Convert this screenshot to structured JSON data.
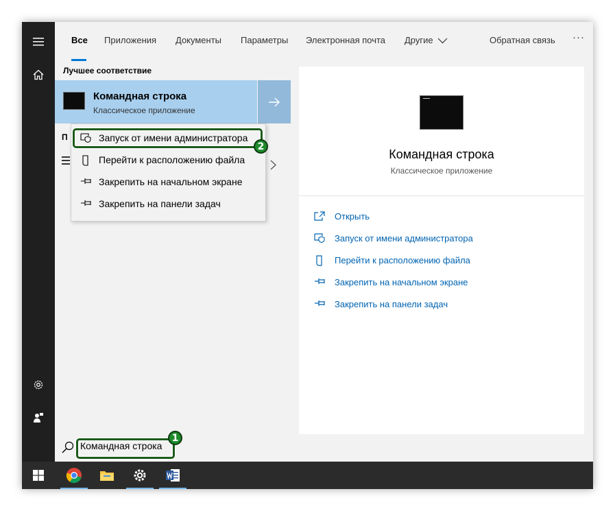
{
  "tabs": [
    {
      "label": "Все",
      "active": true
    },
    {
      "label": "Приложения"
    },
    {
      "label": "Документы"
    },
    {
      "label": "Параметры"
    },
    {
      "label": "Электронная почта"
    },
    {
      "label": "Другие"
    }
  ],
  "feedback_label": "Обратная связь",
  "more_label": "···",
  "results": {
    "best_match_heading": "Лучшее соответствие",
    "best_match": {
      "title": "Командная строка",
      "subtitle": "Классическое приложение"
    },
    "partial_heading": "П"
  },
  "context_menu": {
    "items": [
      {
        "label": "Запуск от имени администратора",
        "icon": "shield-icon"
      },
      {
        "label": "Перейти к расположению файла",
        "icon": "file-location-icon"
      },
      {
        "label": "Закрепить на начальном экране",
        "icon": "pin-icon"
      },
      {
        "label": "Закрепить на панели задач",
        "icon": "pin-icon"
      }
    ]
  },
  "preview": {
    "title": "Командная строка",
    "subtitle": "Классическое приложение",
    "actions": [
      {
        "label": "Открыть",
        "icon": "open-icon"
      },
      {
        "label": "Запуск от имени администратора",
        "icon": "shield-icon"
      },
      {
        "label": "Перейти к расположению файла",
        "icon": "file-location-icon"
      },
      {
        "label": "Закрепить на начальном экране",
        "icon": "pin-icon"
      },
      {
        "label": "Закрепить на панели задач",
        "icon": "pin-icon"
      }
    ]
  },
  "search": {
    "value": "Командная строка"
  },
  "annotations": {
    "step1": "1",
    "step2": "2"
  },
  "colors": {
    "accent": "#0078d7",
    "selection": "#a8cfee",
    "link": "#0063b1",
    "highlight_green": "#1e8a2c"
  },
  "taskbar": {
    "apps": [
      "chrome-icon",
      "file-explorer-icon",
      "settings-icon",
      "word-icon"
    ]
  }
}
